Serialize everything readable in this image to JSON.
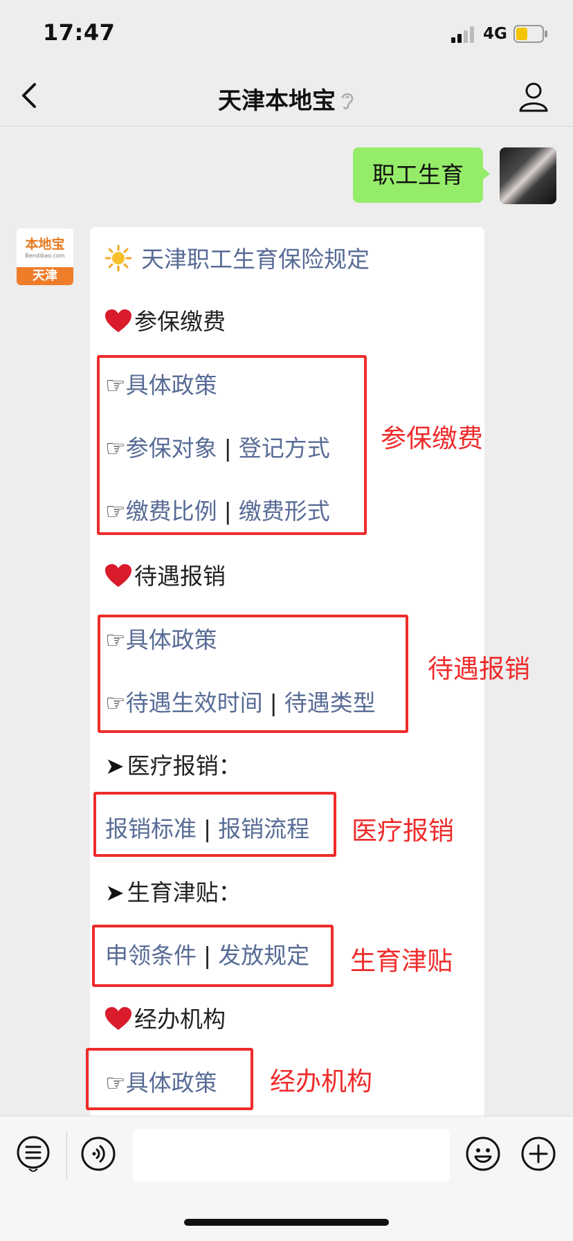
{
  "status_bar": {
    "time": "17:47",
    "network": "4G"
  },
  "nav": {
    "title": "天津本地宝"
  },
  "outgoing_message": {
    "text": "职工生育"
  },
  "bot_avatar": {
    "logo": "本地宝",
    "logo_sub": "Bendibao.com",
    "city": "天津"
  },
  "reply": {
    "title": "天津职工生育保险规定",
    "section1": {
      "heading": "参保缴费",
      "link1": "具体政策",
      "link2a": "参保对象",
      "link2b": "登记方式",
      "link3a": "缴费比例",
      "link3b": "缴费形式"
    },
    "section2": {
      "heading": "待遇报销",
      "link1": "具体政策",
      "link2a": "待遇生效时间",
      "link2b": "待遇类型"
    },
    "sub1": {
      "heading": "医疗报销：",
      "linka": "报销标准",
      "linkb": "报销流程"
    },
    "sub2": {
      "heading": "生育津贴：",
      "linka": "申领条件",
      "linkb": "发放规定"
    },
    "section3": {
      "heading": "经办机构",
      "link1": "具体政策"
    },
    "separator": "|",
    "pointer": "☞",
    "arrow": "➤"
  },
  "annotations": {
    "label1": "参保缴费",
    "label2": "待遇报销",
    "label3": "医疗报销",
    "label4": "生育津贴",
    "label5": "经办机构"
  },
  "colors": {
    "link": "#576b95",
    "annotation": "#ef2b2b",
    "outgoing_bubble": "#95ec69",
    "background": "#ededed"
  },
  "icons": [
    "signal-icon",
    "battery-icon",
    "back-icon",
    "ear-icon",
    "profile-icon",
    "sun-icon",
    "heart-icon",
    "menu-icon",
    "voice-icon",
    "emoji-icon",
    "plus-icon"
  ]
}
